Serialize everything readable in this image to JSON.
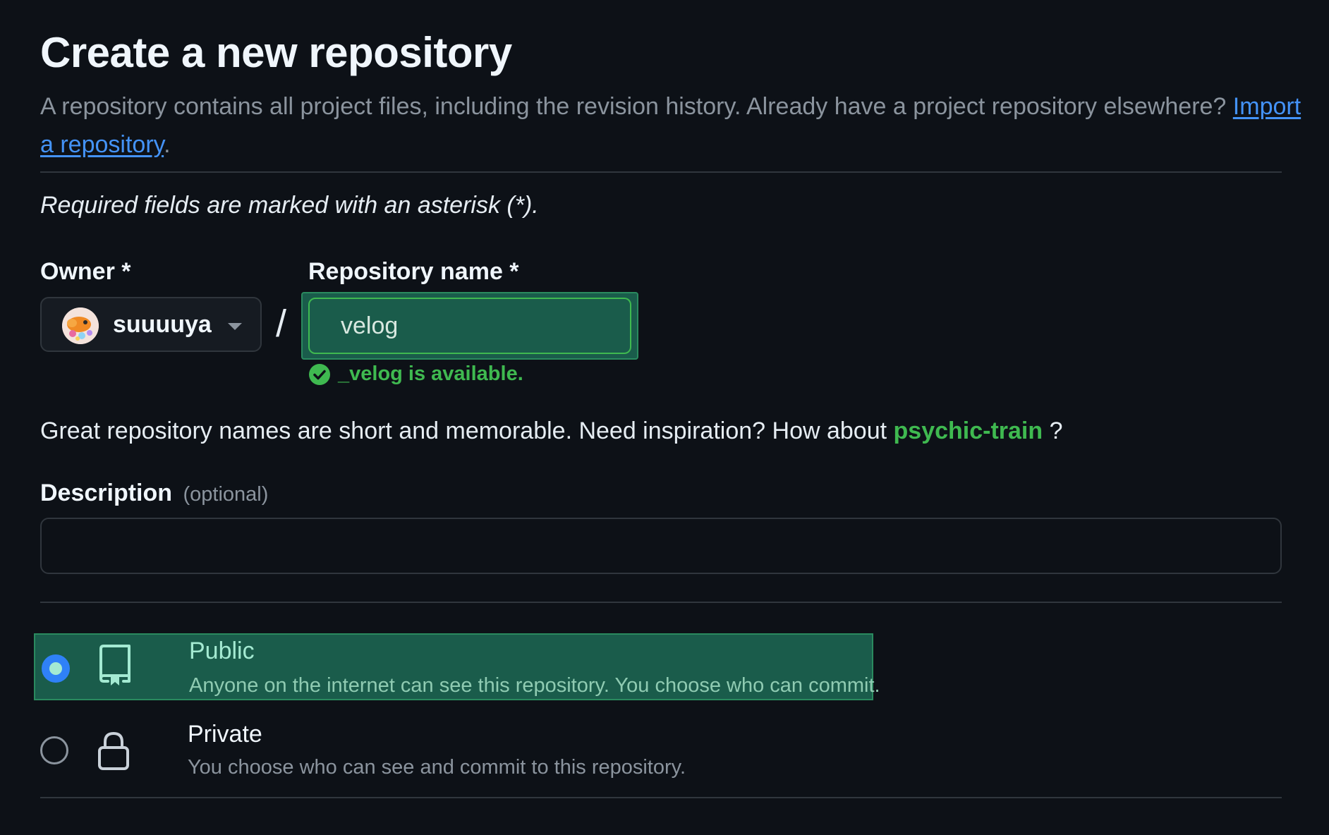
{
  "header": {
    "title": "Create a new repository",
    "intro_text": "A repository contains all project files, including the revision history. Already have a project repository elsewhere?",
    "import_link": "Import a repository",
    "intro_period": "."
  },
  "form": {
    "required_note": "Required fields are marked with an asterisk (*).",
    "owner": {
      "label": "Owner *",
      "value": "suuuuya",
      "icon": "avatar-image",
      "caret_icon": "triangle-down-icon"
    },
    "separator": "/",
    "repo_name": {
      "label": "Repository name *",
      "value": "velog",
      "availability_text": "_velog is available.",
      "availability_icon": "check-circle-icon"
    },
    "suggestion": {
      "prefix": "Great repository names are short and memorable. Need inspiration? How about",
      "suggested_name": "psychic-train",
      "suffix": "?"
    },
    "description": {
      "label": "Description",
      "optional": "(optional)",
      "value": ""
    },
    "visibility": {
      "selected": "public",
      "options": [
        {
          "id": "public",
          "icon": "repo-icon",
          "title": "Public",
          "description": "Anyone on the internet can see this repository. You choose who can commit."
        },
        {
          "id": "private",
          "icon": "lock-icon",
          "title": "Private",
          "description": "You choose who can see and commit to this repository."
        }
      ]
    }
  },
  "colors": {
    "background": "#0d1117",
    "accent_green": "#3fb950",
    "link_blue": "#4493f8",
    "selected_bg": "#1a5c4b",
    "border": "#30363d"
  }
}
